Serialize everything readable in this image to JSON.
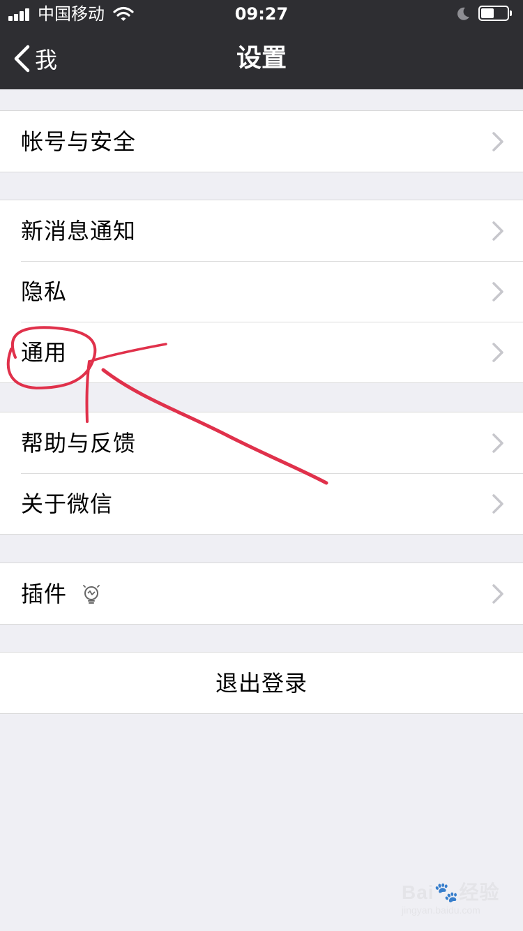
{
  "status_bar": {
    "carrier": "中国移动",
    "time": "09:27",
    "battery_level": 0.5
  },
  "nav": {
    "back_label": "我",
    "title": "设置"
  },
  "groups": [
    {
      "items": [
        {
          "label": "帐号与安全",
          "icon": "chevron-right-icon"
        }
      ]
    },
    {
      "items": [
        {
          "label": "新消息通知",
          "icon": "chevron-right-icon"
        },
        {
          "label": "隐私",
          "icon": "chevron-right-icon"
        },
        {
          "label": "通用",
          "icon": "chevron-right-icon"
        }
      ]
    },
    {
      "items": [
        {
          "label": "帮助与反馈",
          "icon": "chevron-right-icon"
        },
        {
          "label": "关于微信",
          "icon": "chevron-right-icon"
        }
      ]
    },
    {
      "items": [
        {
          "label": "插件",
          "icon": "lightbulb-icon"
        }
      ]
    }
  ],
  "logout": {
    "label": "退出登录"
  },
  "annotation": {
    "color": "#e0314b",
    "target": "通用"
  },
  "watermark": {
    "brand": "Bai",
    "suffix": "经验",
    "url": "jingyan.baidu.com"
  },
  "colors": {
    "topbar": "#2e2e32",
    "background": "#efeff4",
    "chevron": "#c7c7cc"
  }
}
